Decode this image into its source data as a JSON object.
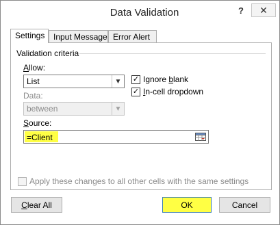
{
  "dialog": {
    "title": "Data Validation",
    "help_glyph": "?",
    "close_glyph": "✕"
  },
  "tabs": [
    {
      "label": "Settings",
      "active": true
    },
    {
      "label": "Input Message",
      "active": false
    },
    {
      "label": "Error Alert",
      "active": false
    }
  ],
  "settings": {
    "group_title": "Validation criteria",
    "allow": {
      "label_u": "A",
      "label_rest": "llow:",
      "value": "List"
    },
    "data": {
      "label": "Data:",
      "value": "between",
      "enabled": false
    },
    "ignore_blank": {
      "label_pre": "Ignore ",
      "label_u": "b",
      "label_rest": "lank",
      "checked": true
    },
    "in_cell_dropdown": {
      "label_u": "I",
      "label_rest": "n-cell dropdown",
      "checked": true
    },
    "source": {
      "label_u": "S",
      "label_rest": "ource:",
      "value": "=Client",
      "highlight_color": "#ffff44"
    },
    "apply_all": {
      "label": "Apply these changes to all other cells with the same settings",
      "checked": false,
      "enabled": false
    }
  },
  "buttons": {
    "clear_all": {
      "label_u": "C",
      "label_rest": "lear All"
    },
    "ok": {
      "label": "OK",
      "highlight_color": "#ffff44"
    },
    "cancel": {
      "label": "Cancel"
    }
  },
  "icons": {
    "checkmark": "✓",
    "dropdown_arrow": "▼"
  }
}
